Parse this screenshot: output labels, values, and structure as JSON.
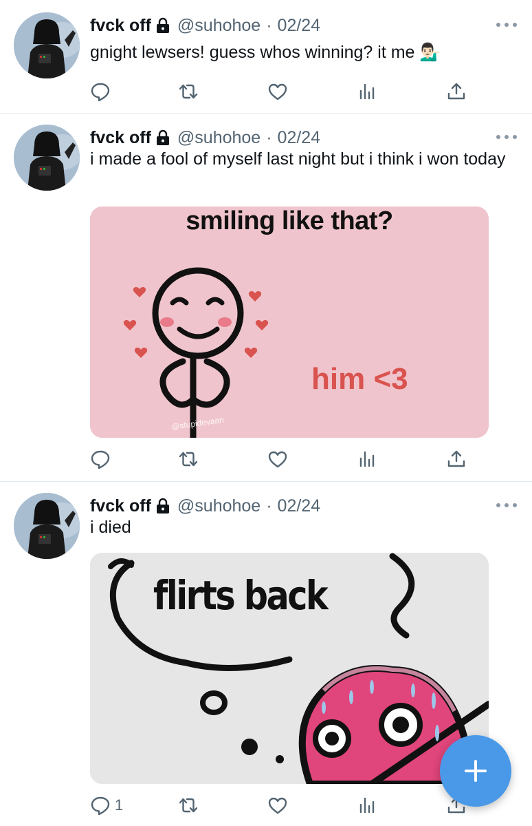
{
  "tweets": [
    {
      "author_name": "fvck off",
      "handle": "@suhohoe",
      "separator": "·",
      "date": "02/24",
      "text": "gnight lewsers! guess whos winning? it me 💁🏻‍♂️",
      "reply_count": "",
      "media": null
    },
    {
      "author_name": "fvck off",
      "handle": "@suhohoe",
      "separator": "·",
      "date": "02/24",
      "text": "i made a fool of myself last night but i think i won today",
      "reply_count": "",
      "media": {
        "caption_top": "smiling like that?",
        "caption_side": "him <3",
        "watermark": "@stupidevaan",
        "background": "#f0c4cc",
        "accent": "#d9534f"
      }
    },
    {
      "author_name": "fvck off",
      "handle": "@suhohoe",
      "separator": "·",
      "date": "02/24",
      "text": "i died",
      "reply_count": "1",
      "media": {
        "caption": "flirts back",
        "background": "#e6e6e6",
        "accent": "#e0457b"
      }
    }
  ],
  "icons": {
    "reply": "reply-icon",
    "retweet": "retweet-icon",
    "like": "like-icon",
    "analytics": "analytics-icon",
    "share": "share-icon",
    "more": "more-icon",
    "lock": "lock-icon",
    "compose": "compose-plus-icon"
  },
  "colors": {
    "primary": "#4a99e9",
    "secondary_text": "#536471",
    "divider": "#e1e8ed"
  }
}
